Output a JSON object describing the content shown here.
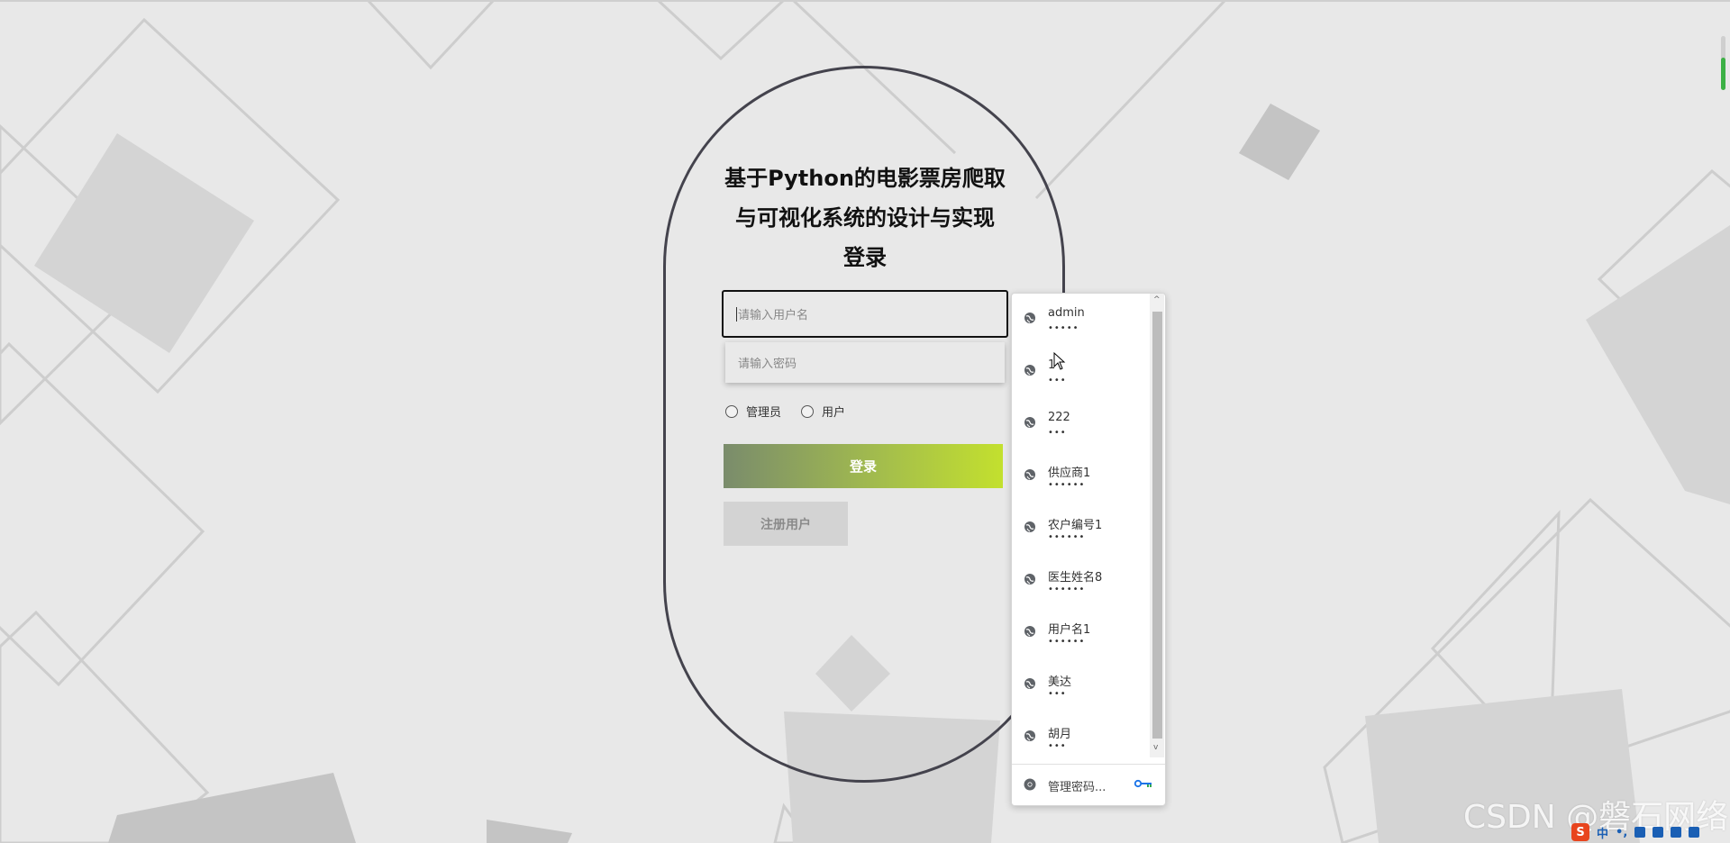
{
  "title": {
    "line1": "基于Python的电影票房爬取",
    "line2": "与可视化系统的设计与实现",
    "line3": "登录"
  },
  "form": {
    "username_placeholder": "请输入用户名",
    "password_placeholder": "请输入密码",
    "role_admin": "管理员",
    "role_user": "用户",
    "login_button": "登录",
    "register_button": "注册用户"
  },
  "autofill": {
    "items": [
      {
        "username": "admin",
        "password_mask": "•••••"
      },
      {
        "username": "1",
        "password_mask": "•••"
      },
      {
        "username": "222",
        "password_mask": "•••"
      },
      {
        "username": "供应商1",
        "password_mask": "••••••"
      },
      {
        "username": "农户编号1",
        "password_mask": "••••••"
      },
      {
        "username": "医生姓名8",
        "password_mask": "••••••"
      },
      {
        "username": "用户名1",
        "password_mask": "••••••"
      },
      {
        "username": "美达",
        "password_mask": "•••"
      },
      {
        "username": "胡月",
        "password_mask": "•••"
      }
    ],
    "manage_label": "管理密码...",
    "scroll_up": "^",
    "scroll_down": "v"
  },
  "watermark": "CSDN @磐石网络",
  "tray": {
    "ime_logo": "S",
    "ime_lang": "中",
    "punct": "•,"
  },
  "icons": {
    "item_icon": "globe-icon",
    "footer_icon": "chrome-icon",
    "key_icon": "key-icon"
  }
}
